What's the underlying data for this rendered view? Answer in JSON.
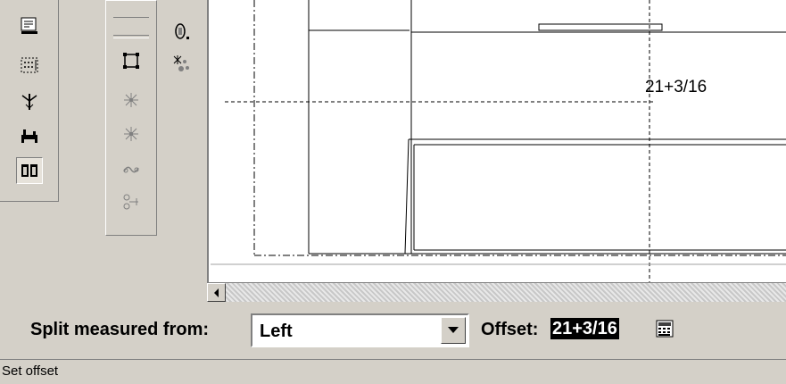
{
  "toolbar_left": {
    "icons": [
      "report-icon",
      "grid-icon",
      "split-tool-icon",
      "table-tool-icon",
      "split-view-icon"
    ]
  },
  "toolbar_middle": {
    "icons": [
      "frame-icon",
      "star-point-icon",
      "star-point-2-icon",
      "chain-icon",
      "node-icon"
    ]
  },
  "toolbar_right": {
    "icons": [
      "zero-icon",
      "pattern-icon"
    ]
  },
  "drawing": {
    "dimension_label": "21+3/16"
  },
  "property_bar": {
    "split_label": "Split measured from:",
    "split_value": "Left",
    "offset_label": "Offset:",
    "offset_value": "21+3/16"
  },
  "status_bar": {
    "text": "Set offset"
  }
}
